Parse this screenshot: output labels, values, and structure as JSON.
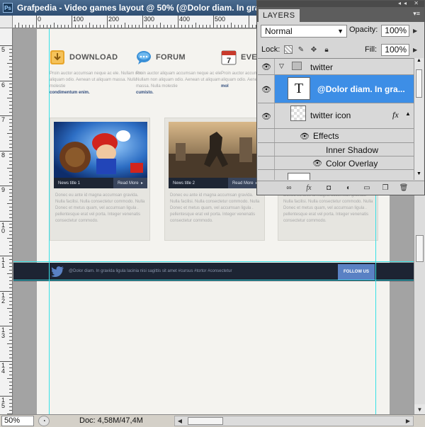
{
  "document": {
    "title": "Grafpedia - Video games layout @ 50% (@Dolor diam. In gra",
    "app_badge": "Ps",
    "zoom": "50%",
    "doc_size": "Doc: 4,58M/47,4M"
  },
  "rulers": {
    "top": [
      "0",
      "100",
      "200",
      "300",
      "400",
      "500"
    ],
    "left": [
      "5",
      "6",
      "7",
      "8",
      "9",
      "10",
      "11",
      "12",
      "13",
      "14",
      "15"
    ]
  },
  "website": {
    "features": [
      {
        "title": "DOWNLOAD",
        "body": "Proin auctor accumsan neque ac ele. Nullam non aliquam odio. Aenean ut aliquam massa. Nulla molestie",
        "link": "condimentum enim."
      },
      {
        "title": "FORUM",
        "body": "Proin auctor aliquam accumsan neque ac ele. Nullam non aliquam odio. Aenean ut aliquam massa. Nulla molestie",
        "link": "cumisto."
      },
      {
        "title": "EVE",
        "calendar_number": "7",
        "body": "Proin auctor accumsan neque ac ele. Nullam non aliquam odio. Aenean ut aliquam massa. Nulla",
        "link": "mol"
      }
    ],
    "cards": [
      {
        "title": "News title 1",
        "more": "Read More",
        "text": "Donec eu ante id magna accumsan gravida. Nulla facilisi. Nulla consectetur commodo. Nulla Donec et metus quam, vel accumsan ligula . pellentesque erat vel porta. Integer venenatis consectetur commodo."
      },
      {
        "title": "News title 2",
        "more": "Read More",
        "text": "Donec eu ante id magna accumsan gravida. Nulla facilisi. Nulla consectetur commodo. Nulla Donec et metus quam, vel accumsan ligula . pellentesque erat vel porta. Integer venenatis consectetur commodo."
      },
      {
        "title": "",
        "more": "",
        "text": "Donec eu ante id magna accumsan gravida. Nulla facilisi. Nulla consectetur commodo. Nulla Donec et metus quam, vel accumsan ligula . pellentesque erat vel porta. Integer venenatis consectetur commodo."
      }
    ],
    "footer": {
      "tweet": "@Dolor diam. In gravida ligula lacinia nisi sagittis sit amet #cursus #tortor #consectetur",
      "follow_label": "FOLLOW US"
    }
  },
  "layers_panel": {
    "tab": "LAYERS",
    "blend_mode": "Normal",
    "opacity_label": "Opacity:",
    "opacity": "100%",
    "lock_label": "Lock:",
    "fill_label": "Fill:",
    "fill": "100%",
    "layers": [
      {
        "name": "twitter",
        "kind": "group"
      },
      {
        "name": "@Dolor diam. In gra...",
        "kind": "text",
        "selected": true
      },
      {
        "name": "twitter icon",
        "kind": "smart",
        "fx": "fx"
      },
      {
        "name": "Effects",
        "kind": "effects"
      },
      {
        "name": "Inner Shadow",
        "kind": "effect"
      },
      {
        "name": "Color Overlay",
        "kind": "effect"
      }
    ],
    "text_thumb": "T"
  },
  "colors": {
    "selection": "#3d8ee6",
    "guide": "#37e0e6",
    "footer_bg": "#1d2433",
    "follow_btn": "#5a81c4"
  }
}
